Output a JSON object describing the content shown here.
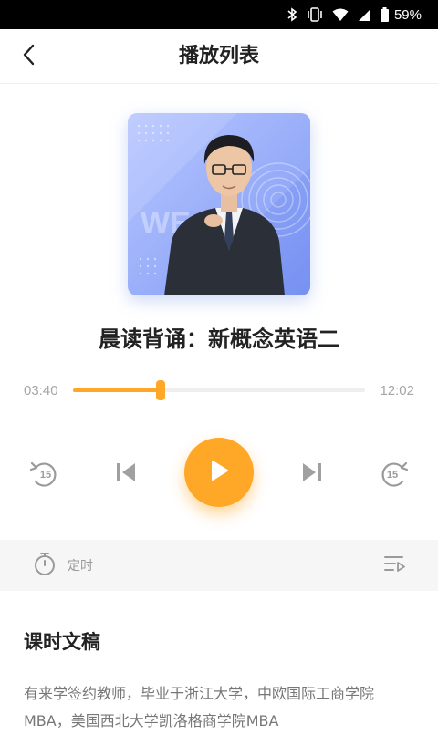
{
  "status_bar": {
    "battery": "59%",
    "icons": [
      "bluetooth-icon",
      "vibrate-icon",
      "wifi-icon",
      "signal-icon",
      "battery-icon"
    ]
  },
  "header": {
    "title": "播放列表",
    "back_icon": "chevron-left-icon"
  },
  "player": {
    "cover_icon": "teacher-portrait",
    "lesson_title": "晨读背诵：新概念英语二",
    "current_time": "03:40",
    "total_time": "12:02",
    "progress_fraction": 0.3,
    "rewind_label": "15",
    "forward_label": "15",
    "accent_color": "#ffa726"
  },
  "timer": {
    "label": "定时",
    "timer_icon": "stopwatch-icon",
    "playlist_icon": "playlist-icon"
  },
  "transcript": {
    "title": "课时文稿",
    "body": "有来学签约教师，毕业于浙江大学，中欧国际工商学院MBA，美国西北大学凯洛格商学院MBA"
  }
}
